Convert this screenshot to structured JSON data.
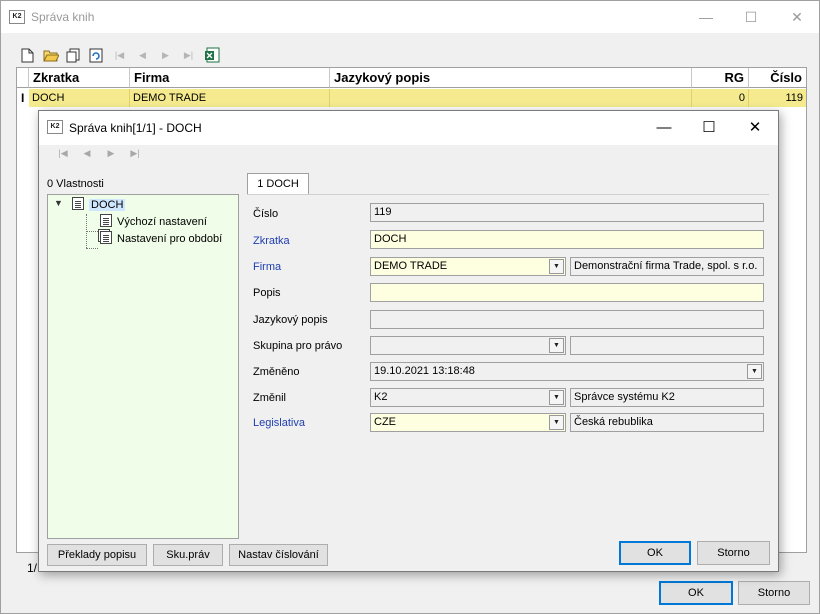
{
  "outer": {
    "title": "Správa knih",
    "app_logo": "K2",
    "window_controls": [
      "minimize-icon",
      "maximize-icon",
      "close-icon"
    ],
    "toolbar_icons": [
      "new-document-icon",
      "open-folder-icon",
      "copy-icon",
      "refresh-icon",
      "first-record-icon",
      "previous-record-icon",
      "next-record-icon",
      "last-record-icon",
      "excel-export-icon"
    ],
    "columns": [
      "Zkratka",
      "Firma",
      "Jazykový popis",
      "RG",
      "Číslo"
    ],
    "rows": [
      {
        "zkratka": "DOCH",
        "firma": "DEMO TRADE",
        "jazykovy_popis": "",
        "rg": "0",
        "cislo": "119"
      }
    ],
    "row_indicator": "I",
    "status_partial": "1/",
    "ok_label": "OK",
    "cancel_label": "Storno"
  },
  "dialog": {
    "title": "Správa knih[1/1] - DOCH",
    "app_logo": "K2",
    "nav_icons": [
      "first-record-icon",
      "previous-record-icon",
      "next-record-icon",
      "last-record-icon"
    ],
    "tree_header": "0 Vlastnosti",
    "tree": {
      "root": "DOCH",
      "children": [
        "Výchozí nastavení",
        "Nastavení pro období"
      ]
    },
    "tab": "1 DOCH",
    "fields": {
      "cislo": {
        "label": "Číslo",
        "value": "119"
      },
      "zkratka": {
        "label": "Zkratka",
        "value": "DOCH"
      },
      "firma": {
        "label": "Firma",
        "value": "DEMO TRADE",
        "desc": "Demonstrační firma Trade, spol. s r.o."
      },
      "popis": {
        "label": "Popis",
        "value": ""
      },
      "jazykovy_popis": {
        "label": "Jazykový popis",
        "value": ""
      },
      "skupina": {
        "label": "Skupina pro právo",
        "value": "",
        "desc": ""
      },
      "zmeneno": {
        "label": "Změněno",
        "value": "19.10.2021 13:18:48"
      },
      "zmenil": {
        "label": "Změnil",
        "value": "K2",
        "desc": "Správce systému K2"
      },
      "legislativa": {
        "label": "Legislativa",
        "value": "CZE",
        "desc": "Česká rebublika"
      }
    },
    "buttons": {
      "preklady": "Překlady popisu",
      "sku_prav": "Sku.práv",
      "nastav_cislovani": "Nastav číslování",
      "ok": "OK",
      "storno": "Storno"
    }
  },
  "colors": {
    "selected_row": "#f5eb8e",
    "tree_background": "#f0fde8",
    "required_field": "#fefee0",
    "link_label": "#1f3fb0",
    "focus_border": "#0078d7"
  }
}
